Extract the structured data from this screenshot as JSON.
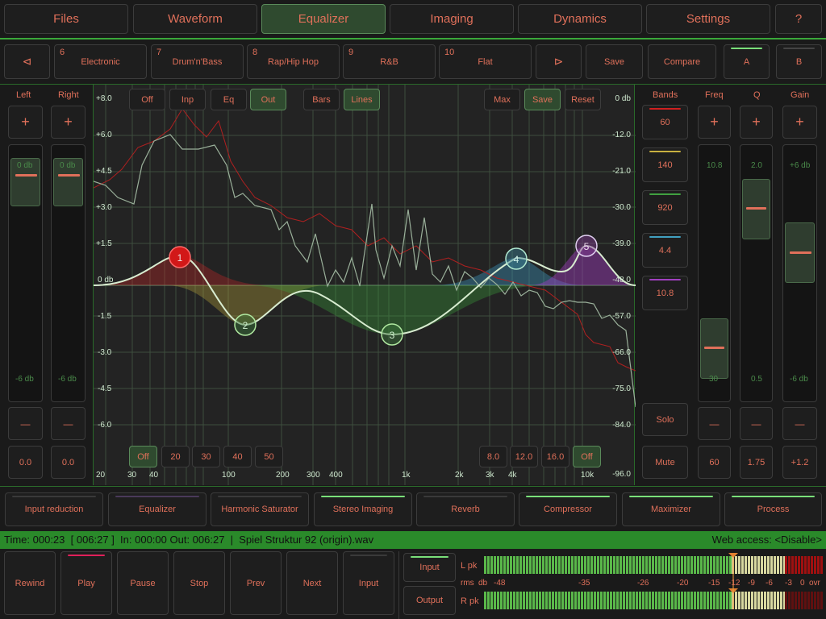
{
  "tabs": [
    "Files",
    "Waveform",
    "Equalizer",
    "Imaging",
    "Dynamics",
    "Settings",
    "?"
  ],
  "presets": [
    {
      "num": "6",
      "label": "Electronic"
    },
    {
      "num": "7",
      "label": "Drum'n'Bass"
    },
    {
      "num": "8",
      "label": "Rap/Hip Hop"
    },
    {
      "num": "9",
      "label": "R&B"
    },
    {
      "num": "10",
      "label": "Flat"
    }
  ],
  "preset_nav": {
    "prev": "⊲",
    "next": "⊳",
    "save": "Save",
    "compare": "Compare",
    "a": "A",
    "b": "B"
  },
  "lr": {
    "left": "Left",
    "right": "Right",
    "plus": "+",
    "minus": "—",
    "top": "0 db",
    "bottom": "-6 db",
    "left_value": "0.0",
    "right_value": "0.0"
  },
  "graph": {
    "top_buttons": [
      "Off",
      "Inp",
      "Eq",
      "Out",
      "Bars",
      "Lines",
      "Max",
      "Save",
      "Reset"
    ],
    "left_axis": [
      "+8.0",
      "+6.0",
      "+4.5",
      "+3.0",
      "+1.5",
      "0 db",
      "-1.5",
      "-3.0",
      "-4.5",
      "-6.0"
    ],
    "right_axis": [
      "0 db",
      "-12.0",
      "-21.0",
      "-30.0",
      "-39.0",
      "-48.0",
      "-57.0",
      "-66.0",
      "-75.0",
      "-84.0",
      "-96.0"
    ],
    "freq_labels": [
      "20",
      "30",
      "40",
      "100",
      "200",
      "300",
      "400",
      "1k",
      "2k",
      "3k",
      "4k",
      "10k"
    ],
    "bottom_left_buttons": [
      "Off",
      "20",
      "30",
      "40",
      "50"
    ],
    "bottom_right_buttons": [
      "8.0",
      "12.0",
      "16.0",
      "Off"
    ],
    "nodes": [
      "1",
      "2",
      "3",
      "4",
      "5"
    ]
  },
  "bands": {
    "label": "Bands",
    "values": [
      "60",
      "140",
      "920",
      "4.4",
      "10.8"
    ],
    "colors": [
      "#d02020",
      "#c8b040",
      "#40a040",
      "#40a0c0",
      "#a040c0"
    ],
    "solo": "Solo",
    "mute": "Mute"
  },
  "params": {
    "freq": {
      "label": "Freq",
      "top": "10.8",
      "bottom": "30",
      "value": "60"
    },
    "q": {
      "label": "Q",
      "top": "2.0",
      "bottom": "0.5",
      "value": "1.75"
    },
    "gain": {
      "label": "Gain",
      "top": "+6 db",
      "bottom": "-6 db",
      "value": "+1.2"
    },
    "plus": "+",
    "minus": "—"
  },
  "modules": [
    "Input reduction",
    "Equalizer",
    "Harmonic Saturator",
    "Stereo Imaging",
    "Reverb",
    "Compressor",
    "Maximizer",
    "Process"
  ],
  "status": {
    "left": "Time: 000:23  [ 006:27 ]  In: 000:00 Out: 006:27  |  Spiel Struktur 92 (origin).wav",
    "right": "Web access: <Disable>"
  },
  "transport": [
    "Rewind",
    "Play",
    "Pause",
    "Stop",
    "Prev",
    "Next",
    "Input"
  ],
  "io": {
    "input": "Input",
    "output": "Output"
  },
  "meter": {
    "lpk": "L pk",
    "rpk": "R pk",
    "rms": "rms",
    "db": "db",
    "scale": [
      "-48",
      "-35",
      "-26",
      "-20",
      "-15",
      "-12",
      "-9",
      "-6",
      "-3",
      "0",
      "ovr"
    ]
  }
}
